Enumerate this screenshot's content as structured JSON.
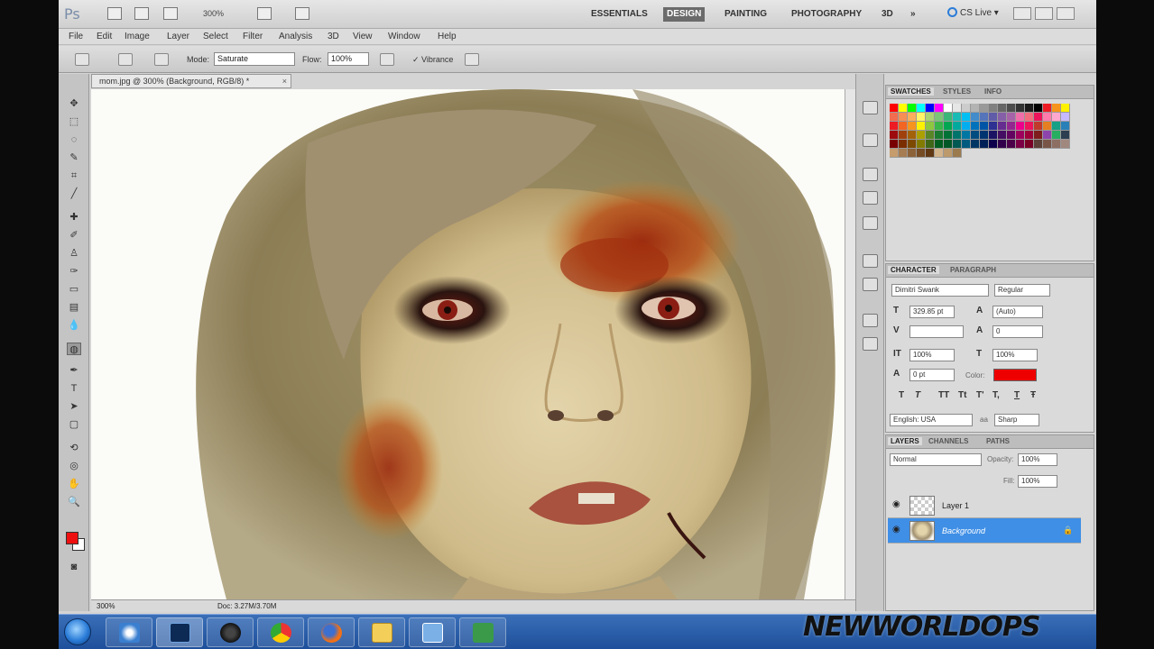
{
  "app": {
    "logo": "Ps",
    "zoom": "300%",
    "workspaces": [
      "ESSENTIALS",
      "DESIGN",
      "PAINTING",
      "PHOTOGRAPHY",
      "3D",
      "»"
    ],
    "active_workspace": "DESIGN",
    "cs_live": "CS Live ▾"
  },
  "menu": [
    "File",
    "Edit",
    "Image",
    "Layer",
    "Select",
    "Filter",
    "Analysis",
    "3D",
    "View",
    "Window",
    "Help"
  ],
  "options": {
    "mode_label": "Mode:",
    "mode_value": "Saturate",
    "flow_label": "Flow:",
    "flow_value": "100%",
    "vibrance_label": "Vibrance"
  },
  "document": {
    "tab_title": "mom.jpg @ 300% (Background, RGB/8) *",
    "tab_close": "×",
    "status_zoom": "300%",
    "status_doc": "Doc: 3.27M/3.70M"
  },
  "swatches": {
    "tabs": [
      "SWATCHES",
      "STYLES",
      "INFO"
    ],
    "colors": [
      "#ff0000",
      "#ffff00",
      "#00ff00",
      "#00ffff",
      "#0000ff",
      "#ff00ff",
      "#ffffff",
      "#e6e6e6",
      "#cccccc",
      "#b3b3b3",
      "#999999",
      "#808080",
      "#666666",
      "#4d4d4d",
      "#333333",
      "#1a1a1a",
      "#000000",
      "#ed1c24",
      "#f7941d",
      "#fff200",
      "#f26c4f",
      "#f68e55",
      "#fbaf5c",
      "#fff467",
      "#acd372",
      "#7cc576",
      "#3bb878",
      "#1abbb4",
      "#00bff3",
      "#438ccb",
      "#5574b9",
      "#605ca8",
      "#855fa8",
      "#a763a8",
      "#f06ea9",
      "#f26d7d",
      "#ed145b",
      "#ff7bac",
      "#ffa8cf",
      "#c6b9ff",
      "#ed1c24",
      "#f26522",
      "#f7941d",
      "#fff200",
      "#8dc63f",
      "#39b54a",
      "#00a651",
      "#00a99d",
      "#00aeef",
      "#0072bc",
      "#0054a6",
      "#2e3192",
      "#662d91",
      "#92278f",
      "#ec008c",
      "#ed145b",
      "#c0392b",
      "#e67e22",
      "#16a085",
      "#2980b9",
      "#9e0b0f",
      "#a0410d",
      "#a36209",
      "#aba000",
      "#598527",
      "#1a7b30",
      "#007236",
      "#00746b",
      "#0076a3",
      "#004b80",
      "#003471",
      "#1b1464",
      "#440e62",
      "#630460",
      "#9e005d",
      "#9e0039",
      "#7f1d1d",
      "#8e44ad",
      "#27ae60",
      "#2c3e50",
      "#790000",
      "#7b2e00",
      "#7d4900",
      "#827b00",
      "#406618",
      "#005e20",
      "#005826",
      "#005952",
      "#005b7f",
      "#003663",
      "#002157",
      "#0d004c",
      "#32004b",
      "#4b0049",
      "#7b0046",
      "#7a0026",
      "#5d4037",
      "#795548",
      "#8d6e63",
      "#a1887f",
      "#c69c6d",
      "#a67c52",
      "#8c6239",
      "#754c24",
      "#603813",
      "#d2b48c",
      "#bc9a6c",
      "#9b7a4e"
    ]
  },
  "character": {
    "tabs": [
      "CHARACTER",
      "PARAGRAPH"
    ],
    "font_family": "Dimitri Swank",
    "font_style": "Regular",
    "font_size": "329.85 pt",
    "leading": "(Auto)",
    "tracking": "0",
    "vscale": "100%",
    "hscale": "100%",
    "baseline": "0 pt",
    "color_label": "Color:",
    "style_buttons": [
      "T",
      "T",
      "TT",
      "Tt",
      "T'",
      "T,",
      "T",
      "Ŧ"
    ],
    "language": "English: USA",
    "aa_method": "Sharp",
    "aa_label": "aa",
    "color": "#ee0000"
  },
  "layers": {
    "tabs": [
      "LAYERS",
      "CHANNELS",
      "PATHS"
    ],
    "blend_mode": "Normal",
    "opacity_label": "Opacity:",
    "opacity": "100%",
    "fill_label": "Fill:",
    "fill": "100%",
    "items": [
      {
        "name": "Layer 1",
        "selected": false
      },
      {
        "name": "Background",
        "selected": true
      }
    ]
  },
  "taskbar": {
    "apps": [
      "windows-media-player",
      "photoshop",
      "webcam",
      "chrome",
      "firefox",
      "folder",
      "screen-capture",
      "tool"
    ],
    "active_index": 1
  },
  "watermark": "NEWWORLDOPS"
}
